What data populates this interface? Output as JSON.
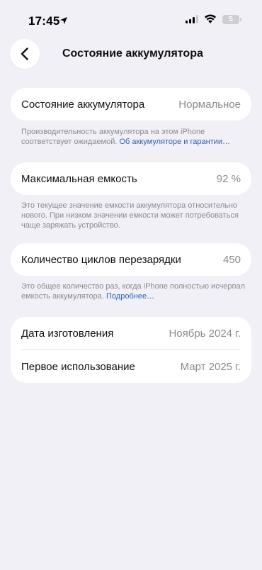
{
  "status_bar": {
    "time": "17:45",
    "battery_level": "5",
    "location_icon": "location-arrow-icon",
    "wifi_icon": "wifi-icon",
    "signal_icon": "cellular-signal-icon"
  },
  "nav": {
    "title": "Состояние аккумулятора",
    "back_icon": "chevron-left-icon"
  },
  "sections": {
    "health": {
      "label": "Состояние аккумулятора",
      "value": "Нормальное",
      "footnote_text": "Производительность аккумулятора на этом iPhone соответствует ожидаемой.",
      "footnote_link": "Об аккумуляторе и гарантии…"
    },
    "capacity": {
      "label": "Максимальная емкость",
      "value": "92 %",
      "footnote_text": "Это текущее значение емкости аккумулятора относительно нового. При низком значении емкости может потребоваться чаще заряжать устройство."
    },
    "cycles": {
      "label": "Количество циклов перезарядки",
      "value": "450",
      "footnote_text": "Это общее количество раз, когда iPhone полностью исчерпал емкость аккумулятора.",
      "footnote_link": "Подробнее…"
    },
    "dates": {
      "manufacture_label": "Дата изготовления",
      "manufacture_value": "Ноябрь 2024 г.",
      "first_use_label": "Первое использование",
      "first_use_value": "Март 2025 г."
    }
  },
  "colors": {
    "background": "#f1f0f6",
    "card": "#ffffff",
    "secondary_text": "#8a8a8f",
    "link": "#2f5fb3"
  }
}
